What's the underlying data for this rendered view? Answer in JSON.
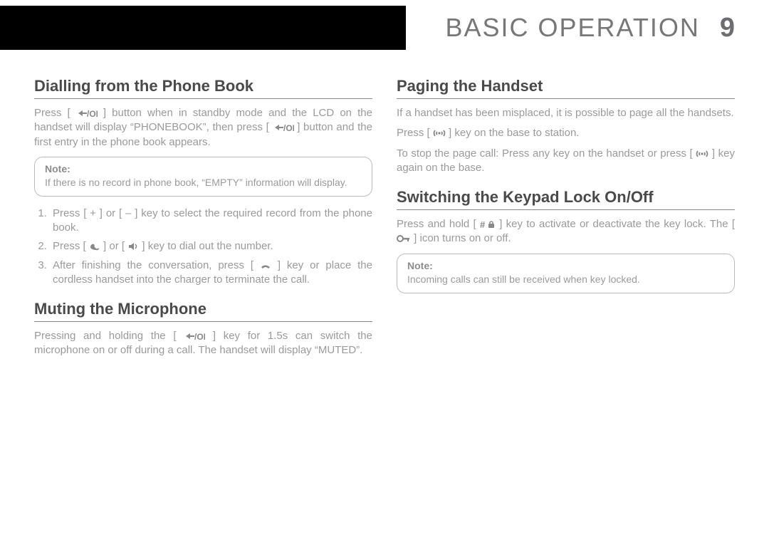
{
  "header": {
    "title": "BASIC OPERATION",
    "page_number": "9"
  },
  "left": {
    "section1": {
      "heading": "Dialling from the Phone Book",
      "p1_a": "Press [ ",
      "p1_b": " ] button when in standby mode and the LCD on the handset will display “PHONEBOOK”, then press [ ",
      "p1_c": " ] button and the first entry in the phone book appears.",
      "note_label": "Note:",
      "note_text": "If there is no record in phone book, “EMPTY” information will display.",
      "li1": "Press [ + ] or [ – ] key to select the required record from the phone book.",
      "li2_a": "Press [ ",
      "li2_b": " ] or [ ",
      "li2_c": " ] key to dial out the number.",
      "li3_a": "After finishing the conversation, press [ ",
      "li3_b": " ] key or place the cordless handset into the charger to terminate the call."
    },
    "section2": {
      "heading": "Muting the Microphone",
      "p1_a": "Pressing and holding the [ ",
      "p1_b": " ] key for 1.5s can switch the microphone on or off during a call. The handset will display “MUTED”."
    }
  },
  "right": {
    "section1": {
      "heading": "Paging the Handset",
      "p1": "If a handset has been misplaced, it is possible to page all the handsets.",
      "p2_a": "Press [ ",
      "p2_b": " ] key on the base to station.",
      "p3_a": "To stop the page call: Press any key on the handset or press [ ",
      "p3_b": " ] key again on the base."
    },
    "section2": {
      "heading": "Switching the Keypad Lock On/Off",
      "p1_a": "Press and hold [ ",
      "p1_b": " ] key to activate or deactivate the key lock. The [ ",
      "p1_c": " ] icon turns on or off.",
      "note_label": "Note:",
      "note_text": "Incoming calls can still be received when key locked."
    }
  }
}
